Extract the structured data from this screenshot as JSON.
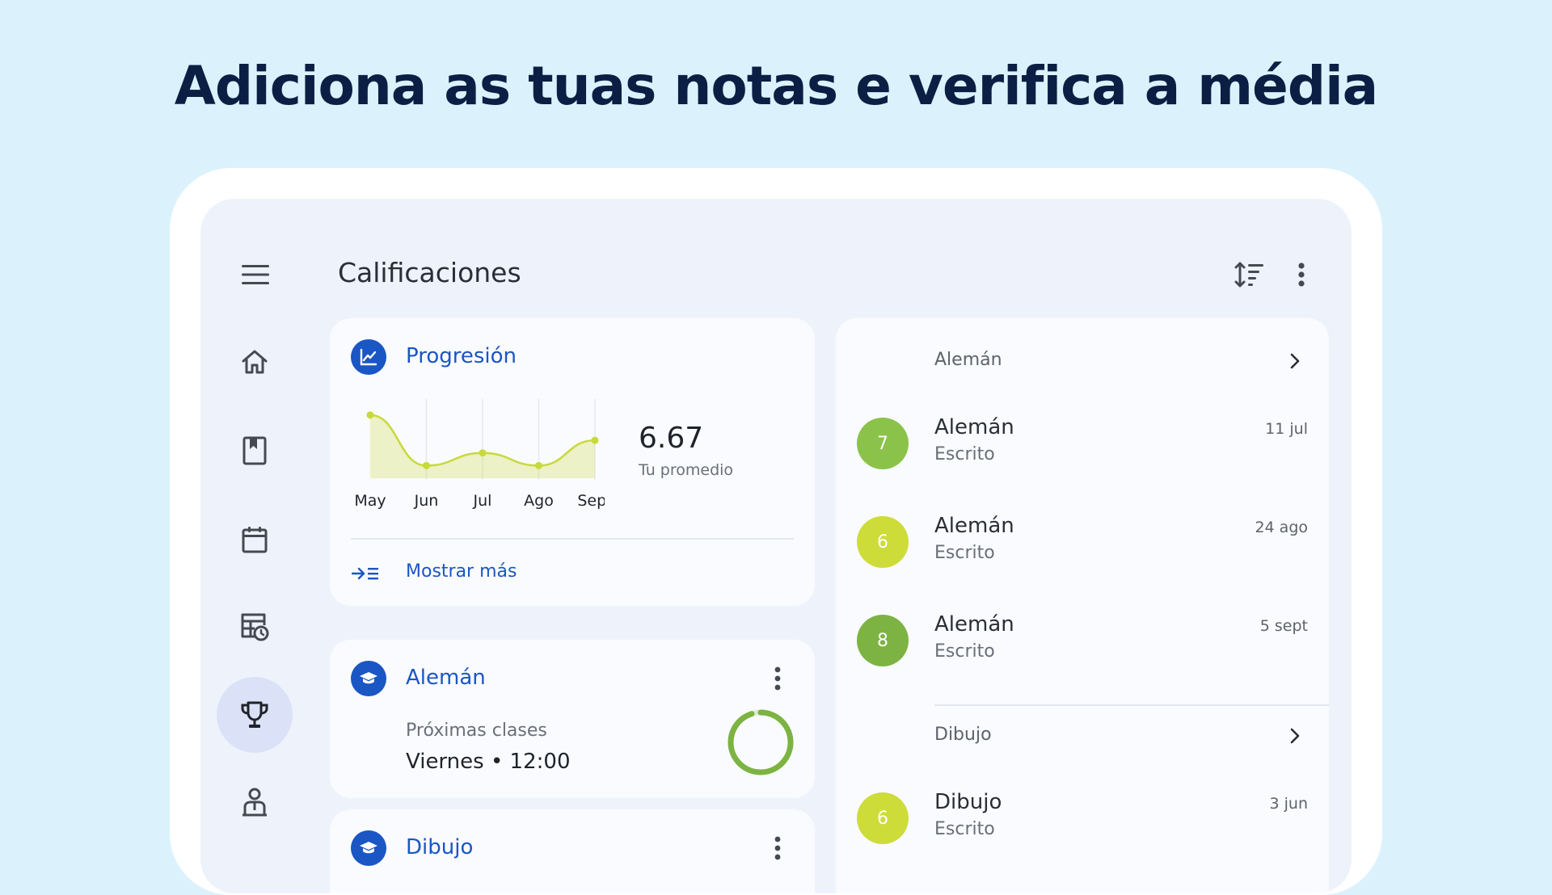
{
  "headline": "Adiciona as tuas notas e verifica a média",
  "topbar": {
    "title": "Calificaciones"
  },
  "progress_card": {
    "title": "Progresión",
    "average": "6.67",
    "average_label": "Tu promedio",
    "show_more": "Mostrar más"
  },
  "chart_data": {
    "type": "area",
    "categories": [
      "May",
      "Jun",
      "Jul",
      "Ago",
      "Sept"
    ],
    "values": [
      10,
      6.0,
      7.0,
      6.0,
      8.0
    ],
    "ylim": [
      5,
      10.5
    ],
    "color": "#c8d93a"
  },
  "subject_cards": [
    {
      "title": "Alemán",
      "next_label": "Próximas clases",
      "next_value": "Viernes • 12:00",
      "ring_fraction": 0.95
    },
    {
      "title": "Dibujo"
    }
  ],
  "grades": [
    {
      "section": "Alemán",
      "items": [
        {
          "grade": "7",
          "title": "Alemán",
          "sub": "Escrito",
          "date": "11 jul",
          "color": "#8bc34a"
        },
        {
          "grade": "6",
          "title": "Alemán",
          "sub": "Escrito",
          "date": "24 ago",
          "color": "#cddc39"
        },
        {
          "grade": "8",
          "title": "Alemán",
          "sub": "Escrito",
          "date": "5 sept",
          "color": "#7cb342"
        }
      ]
    },
    {
      "section": "Dibujo",
      "items": [
        {
          "grade": "6",
          "title": "Dibujo",
          "sub": "Escrito",
          "date": "3 jun",
          "color": "#cddc39"
        }
      ]
    }
  ]
}
